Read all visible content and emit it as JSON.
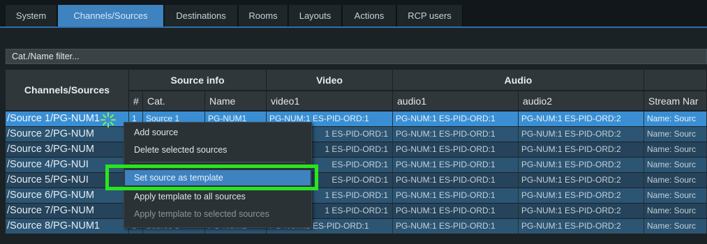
{
  "tabs": [
    "System",
    "Channels/Sources",
    "Destinations",
    "Rooms",
    "Layouts",
    "Actions",
    "RCP users"
  ],
  "active_tab": "Channels/Sources",
  "filter": {
    "placeholder": "Cat./Name filter..."
  },
  "table": {
    "group_headers": {
      "channels": "Channels/Sources",
      "source_info": "Source info",
      "video": "Video",
      "audio": "Audio"
    },
    "columns": [
      "#",
      "Cat.",
      "Name",
      "video1",
      "audio1",
      "audio2",
      "Stream Nar"
    ],
    "rows": [
      {
        "path": "/Source 1/PG-NUM1",
        "num": "1",
        "cat": "Source 1",
        "name": "PG-NUM1",
        "video1": "PG-NUM:1 ES-PID-ORD:1",
        "audio1": "PG-NUM:1 ES-PID-ORD:1",
        "audio2": "PG-NUM:1 ES-PID-ORD:2",
        "stream": "Name: Sourc"
      },
      {
        "path": "/Source 2/PG-NUM",
        "num": "",
        "cat": "",
        "name": "",
        "video1": "1 ES-PID-ORD:1",
        "audio1": "PG-NUM:1 ES-PID-ORD:1",
        "audio2": "PG-NUM:1 ES-PID-ORD:2",
        "stream": "Name: Sourc"
      },
      {
        "path": "/Source 3/PG-NUM",
        "num": "",
        "cat": "",
        "name": "",
        "video1": "1 ES-PID-ORD:1",
        "audio1": "PG-NUM:1 ES-PID-ORD:1",
        "audio2": "PG-NUM:1 ES-PID-ORD:2",
        "stream": "Name: Sourc"
      },
      {
        "path": "/Source 4/PG-NUI",
        "num": "",
        "cat": "",
        "name": "",
        "video1": "ES-PID-ORD:1",
        "audio1": "PG-NUM:1 ES-PID-ORD:1",
        "audio2": "PG-NUM:1 ES-PID-ORD:2",
        "stream": "Name: Sourc"
      },
      {
        "path": "/Source 5/PG-NUI",
        "num": "",
        "cat": "",
        "name": "",
        "video1": "ES-PID-ORD:1",
        "audio1": "PG-NUM:1 ES-PID-ORD:1",
        "audio2": "PG-NUM:1 ES-PID-ORD:2",
        "stream": "Name: Sourc"
      },
      {
        "path": "/Source 6/PG-NUM",
        "num": "",
        "cat": "",
        "name": "",
        "video1": "1 ES-PID-ORD:1",
        "audio1": "PG-NUM:1 ES-PID-ORD:1",
        "audio2": "PG-NUM:1 ES-PID-ORD:2",
        "stream": "Name: Sourc"
      },
      {
        "path": "/Source 7/PG-NUM",
        "num": "",
        "cat": "",
        "name": "",
        "video1": "1 ES-PID-ORD:1",
        "audio1": "PG-NUM:1 ES-PID-ORD:1",
        "audio2": "PG-NUM:1 ES-PID-ORD:2",
        "stream": "Name: Sourc"
      },
      {
        "path": "/Source 8/PG-NUM1",
        "num": "8",
        "cat": "Source 8",
        "name": "PG-NUM1",
        "video1": "PG-NUM:1 ES-PID-ORD:1",
        "audio1": "PG-NUM:1 ES-PID-ORD:1",
        "audio2": "PG-NUM:1 ES-PID-ORD:2",
        "stream": "Name: Sourc"
      }
    ]
  },
  "context_menu": {
    "items": [
      "Add source",
      "Delete selected sources",
      "Set source as template",
      "Apply template to all sources",
      "Apply template to selected sources"
    ],
    "highlighted": "Set source as template",
    "disabled": [
      "Apply template to selected sources"
    ]
  },
  "colors": {
    "accent": "#3e82c0",
    "highlight_box": "#29e51d"
  }
}
